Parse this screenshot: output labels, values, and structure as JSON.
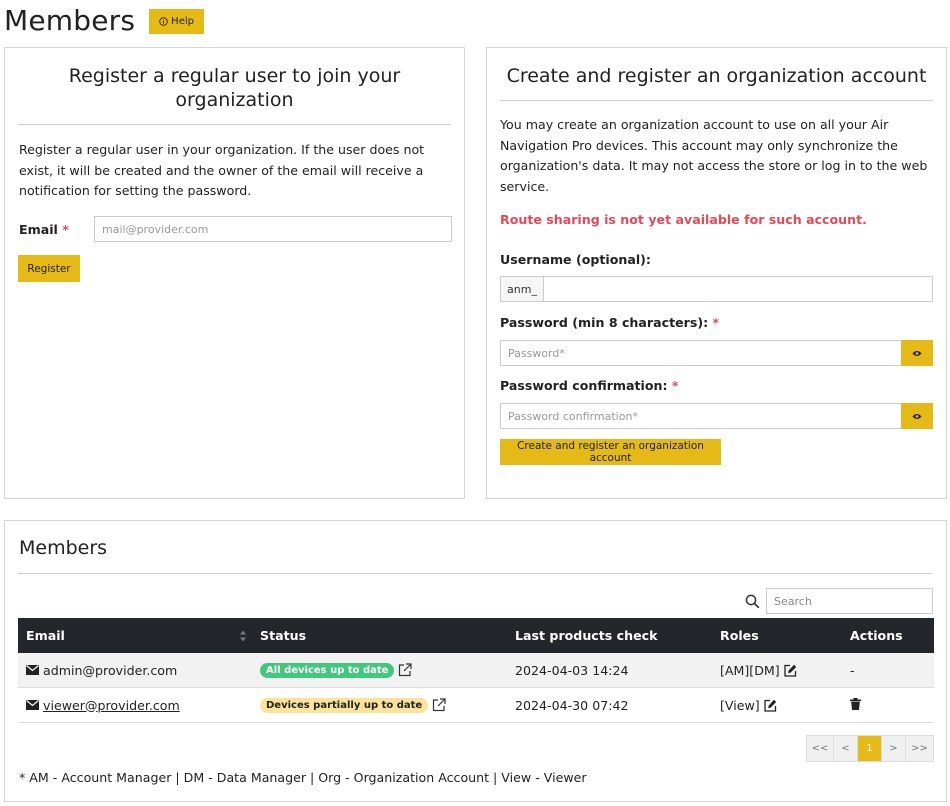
{
  "header": {
    "title": "Members",
    "help_label": "Help"
  },
  "register_user": {
    "title": "Register a regular user to join your organization",
    "description": "Register a regular user in your organization. If the user does not exist, it will be created and the owner of the email will receive a notification for setting the password.",
    "email_label": "Email",
    "required_mark": "*",
    "email_placeholder": "mail@provider.com",
    "register_button": "Register"
  },
  "org_account": {
    "title": "Create and register an organization account",
    "description": "You may create an organization account to use on all your Air Navigation Pro devices. This account may only synchronize the organization's data. It may not access the store or log in to the web service.",
    "warning": "Route sharing is not yet available for such account.",
    "username_label": "Username (optional):",
    "username_prefix": "anm_",
    "password_label": "Password (min 8 characters):",
    "password_placeholder": "Password*",
    "confirm_label": "Password confirmation:",
    "confirm_placeholder": "Password confirmation*",
    "required_mark": "*",
    "create_button": "Create and register an organization account"
  },
  "members": {
    "title": "Members",
    "search_placeholder": "Search",
    "columns": [
      "Email",
      "Status",
      "Last products check",
      "Roles",
      "Actions"
    ],
    "rows": [
      {
        "email": "admin@provider.com",
        "status": "All devices up to date",
        "last_check": "2024-04-03 14:24",
        "roles": "[AM][DM]",
        "actions": "-"
      },
      {
        "email": "viewer@provider.com",
        "status": "Devices partially up to date",
        "last_check": "2024-04-30 07:42",
        "roles": "[View]",
        "actions": ""
      }
    ],
    "pagination": [
      "<<",
      "<",
      "1",
      ">",
      ">>"
    ],
    "legend": "* AM - Account Manager | DM - Data Manager | Org - Organization Account | View - Viewer"
  },
  "colors": {
    "accent": "#e5b916",
    "header_dark": "#23262b",
    "danger": "#e24a5a",
    "success": "#42c77e",
    "warning_bg": "#fbe39a"
  }
}
